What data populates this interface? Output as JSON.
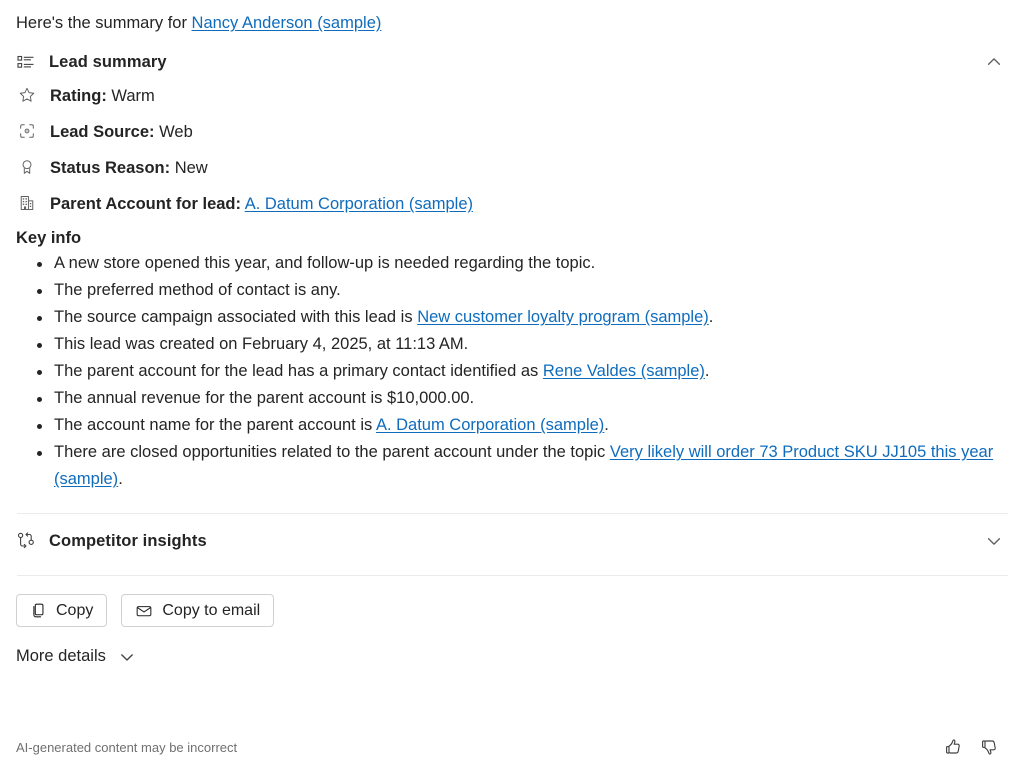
{
  "intro": {
    "prefix": "Here's the summary for ",
    "link": "Nancy Anderson (sample)"
  },
  "lead_summary": {
    "title": "Lead summary",
    "icon": "list-icon",
    "expanded": true,
    "chevron": "chevron-up-icon",
    "fields": [
      {
        "icon": "star-icon",
        "label": "Rating:",
        "value": "Warm"
      },
      {
        "icon": "target-icon",
        "label": "Lead Source:",
        "value": "Web"
      },
      {
        "icon": "ribbon-icon",
        "label": "Status Reason:",
        "value": "New"
      },
      {
        "icon": "building-icon",
        "label": "Parent Account for lead:",
        "value": "A. Datum Corporation (sample)",
        "value_is_link": true
      }
    ],
    "key_info_title": "Key info",
    "key_info": [
      {
        "text_before": "A new store opened this year, and follow-up is needed regarding the topic.",
        "link": "",
        "text_after": ""
      },
      {
        "text_before": "The preferred method of contact is any.",
        "link": "",
        "text_after": ""
      },
      {
        "text_before": "The source campaign associated with this lead is ",
        "link": "New customer loyalty program (sample)",
        "text_after": "."
      },
      {
        "text_before": "This lead was created on February 4, 2025, at 11:13 AM.",
        "link": "",
        "text_after": ""
      },
      {
        "text_before": "The parent account for the lead has a primary contact identified as ",
        "link": "Rene Valdes (sample)",
        "text_after": "."
      },
      {
        "text_before": "The annual revenue for the parent account is $10,000.00.",
        "link": "",
        "text_after": ""
      },
      {
        "text_before": "The account name for the parent account is ",
        "link": "A. Datum Corporation (sample)",
        "text_after": "."
      },
      {
        "text_before": "There are closed opportunities related to the parent account under the topic ",
        "link": "Very likely will order 73 Product SKU JJ105 this year (sample)",
        "text_after": "."
      }
    ]
  },
  "competitor_insights": {
    "title": "Competitor insights",
    "icon": "branch-icon",
    "expanded": false,
    "chevron": "chevron-down-icon"
  },
  "actions": {
    "copy_label": "Copy",
    "copy_icon": "copy-icon",
    "copy_to_email_label": "Copy to email",
    "copy_to_email_icon": "mail-icon"
  },
  "more_details": {
    "label": "More details",
    "chevron": "chevron-down-icon"
  },
  "footer": {
    "disclaimer": "AI-generated content may be incorrect",
    "thumbs_up_icon": "thumbs-up-icon",
    "thumbs_down_icon": "thumbs-down-icon"
  },
  "colors": {
    "link": "#0f6cbd",
    "text": "#242424",
    "muted": "#707070",
    "divider": "#ebebeb",
    "border": "#d1d1d1"
  }
}
